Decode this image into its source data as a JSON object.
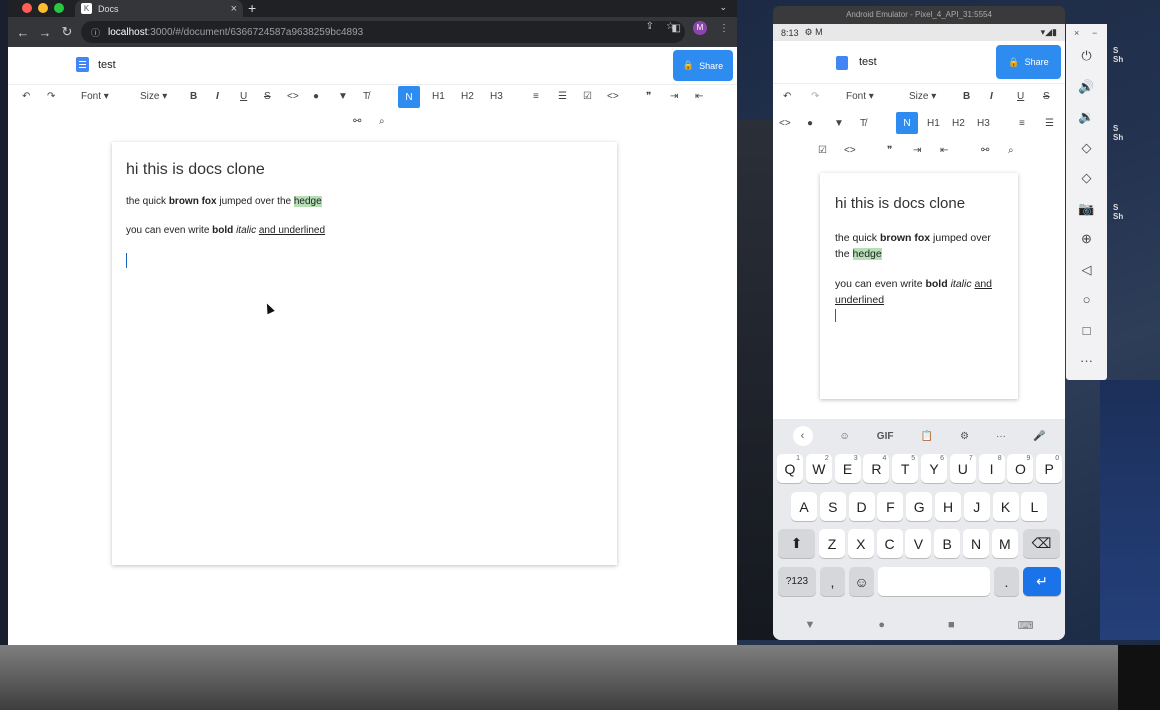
{
  "browser": {
    "tab_title": "Docs",
    "tab_icon": "K",
    "tab_close": "×",
    "new_tab": "+",
    "tab_menu": "⌄",
    "back": "←",
    "forward": "→",
    "reload": "↻",
    "lock_icon": "ⓘ",
    "url_host": "localhost",
    "url_rest": ":3000/#/document/6366724587a9638259bc4893",
    "profile_initial": "M",
    "toolbar_icons": [
      "⇪",
      "☆",
      "◧",
      "⋮"
    ]
  },
  "doc": {
    "title": "test",
    "share_label": "Share",
    "lock_glyph": "🔒"
  },
  "toolbar": {
    "undo": "↶",
    "redo": "↷",
    "font": "Font ▾",
    "size": "Size ▾",
    "bold": "B",
    "italic": "I",
    "underline": "U",
    "strike": "S",
    "code": "<>",
    "color": "●",
    "highlight": "▼",
    "clear": "T̸",
    "normal": "N",
    "h1": "H1",
    "h2": "H2",
    "h3": "H3",
    "ol": "≡",
    "ul": "☰",
    "check": "☑",
    "codeblock": "<>",
    "quote": "❞",
    "indent": "⇥",
    "outdent": "⇤",
    "link": "⚯",
    "search": "⌕"
  },
  "content": {
    "heading": "hi this is docs clone",
    "p1_a": "the quick ",
    "p1_bold": "brown fox",
    "p1_b": " jumped over the ",
    "p1_hl": "hedge",
    "p2_a": "you can even write ",
    "p2_bold": "bold",
    "p2_sp": " ",
    "p2_italic": "italic",
    "p2_sp2": " ",
    "p2_under": "and underlined"
  },
  "emulator": {
    "window_title": "Android Emulator - Pixel_4_API_31:5554",
    "time": "8:13",
    "status_icons": "⚙ M",
    "status_right": "▾◢▮",
    "keyboard": {
      "top": [
        "‹",
        "☺",
        "GIF",
        "📋",
        "⚙",
        "···",
        "🎤"
      ],
      "row1": [
        "Q",
        "W",
        "E",
        "R",
        "T",
        "Y",
        "U",
        "I",
        "O",
        "P"
      ],
      "row1_sup": [
        "1",
        "2",
        "3",
        "4",
        "5",
        "6",
        "7",
        "8",
        "9",
        "0"
      ],
      "row2": [
        "A",
        "S",
        "D",
        "F",
        "G",
        "H",
        "J",
        "K",
        "L"
      ],
      "row3": [
        "Z",
        "X",
        "C",
        "V",
        "B",
        "N",
        "M"
      ],
      "shift": "⬆",
      "backspace": "⌫",
      "sym": "?123",
      "comma": ",",
      "emoji": "☺",
      "period": ".",
      "enter": "↵"
    },
    "nav": [
      "▼",
      "●",
      "■",
      "⌨"
    ],
    "side_controls": [
      "⏻",
      "🔊",
      "🔉",
      "◇",
      "◇",
      "📷",
      "⊕",
      "◁",
      "○",
      "□",
      "···"
    ],
    "close": "×",
    "minimize": "−"
  },
  "side_labels": [
    "S\nSh",
    "S\nSh",
    "S\nSh"
  ],
  "colors": {
    "accent": "#2e8cf0",
    "highlight": "#b7dfb7",
    "chrome_dark": "#202124"
  }
}
